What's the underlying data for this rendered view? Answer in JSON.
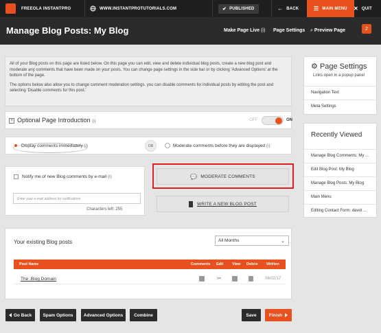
{
  "topbar": {
    "brand": "FREEOLA INSTANTPRO",
    "site_url": "WWW.INSTANTPROTUTORIALS.COM",
    "published": "PUBLISHED",
    "back": "BACK",
    "main_menu": "MAIN MENU",
    "quit": "QUIT"
  },
  "header": {
    "title": "Manage Blog Posts: My Blog",
    "make_live": "Make Page Live",
    "make_live_info": "(i)",
    "page_settings": "Page Settings",
    "preview": "Preview Page",
    "notif_count": "2"
  },
  "intro": {
    "p1": "All of your Blog posts on this page are listed below. On this page you can edit, view and delete individual blog posts, create a new blog post and moderate any comments that have been made on your posts. You can change page settings in the side bar or by clicking 'Advanced Options' at the bottom of the page.",
    "p2": "The options below also allow you to change comment moderation settings. you can disable comments for individual posts by editing the post and selecting 'Disable comments for this post.'"
  },
  "optional_intro": {
    "label": "Optional Page Introduction",
    "info": "(i)",
    "off": "OFF",
    "on": "ON"
  },
  "comments": {
    "immediate": "Display comments immediately",
    "immediate_info": "(i)",
    "or": "OR",
    "moderate": "Moderate comments before they are displayed",
    "moderate_info": "(i)"
  },
  "notify": {
    "label": "Notify me of new Blog comments by e-mail",
    "info": "(i)",
    "placeholder": "Enter your e-mail address for notifications",
    "chars_left": "Characters left: 255"
  },
  "actions": {
    "moderate": "MODERATE COMMENTS",
    "write": "WRITE A NEW BLOG POST"
  },
  "posts": {
    "title": "Your existing Blog posts",
    "filter": "All Months",
    "columns": [
      "Post Name",
      "Comments",
      "Edit",
      "View",
      "Delete",
      "Written"
    ],
    "rows": [
      {
        "name": "The .Blog Domain",
        "written": "06/02/17"
      }
    ]
  },
  "page_settings": {
    "title": "Page Settings",
    "subtitle": "Links open in a popup panel",
    "items": [
      "Navigation Text",
      "Meta Settings"
    ]
  },
  "recently_viewed": {
    "title": "Recently Viewed",
    "items": [
      "Manage Blog Comments: My ...",
      "Edit Blog Post: My Blog",
      "Manage Blog Posts: My Blog",
      "Main Menu",
      "Editing Contact Form: david ..."
    ]
  },
  "footer": {
    "go_back": "Go Back",
    "spam": "Spam Options",
    "advanced": "Advanced Options",
    "combine": "Combine",
    "save": "Save",
    "finish": "Finish"
  },
  "colors": {
    "accent": "#e8501d",
    "dark": "#1f1f1f",
    "highlight": "#e02020"
  }
}
